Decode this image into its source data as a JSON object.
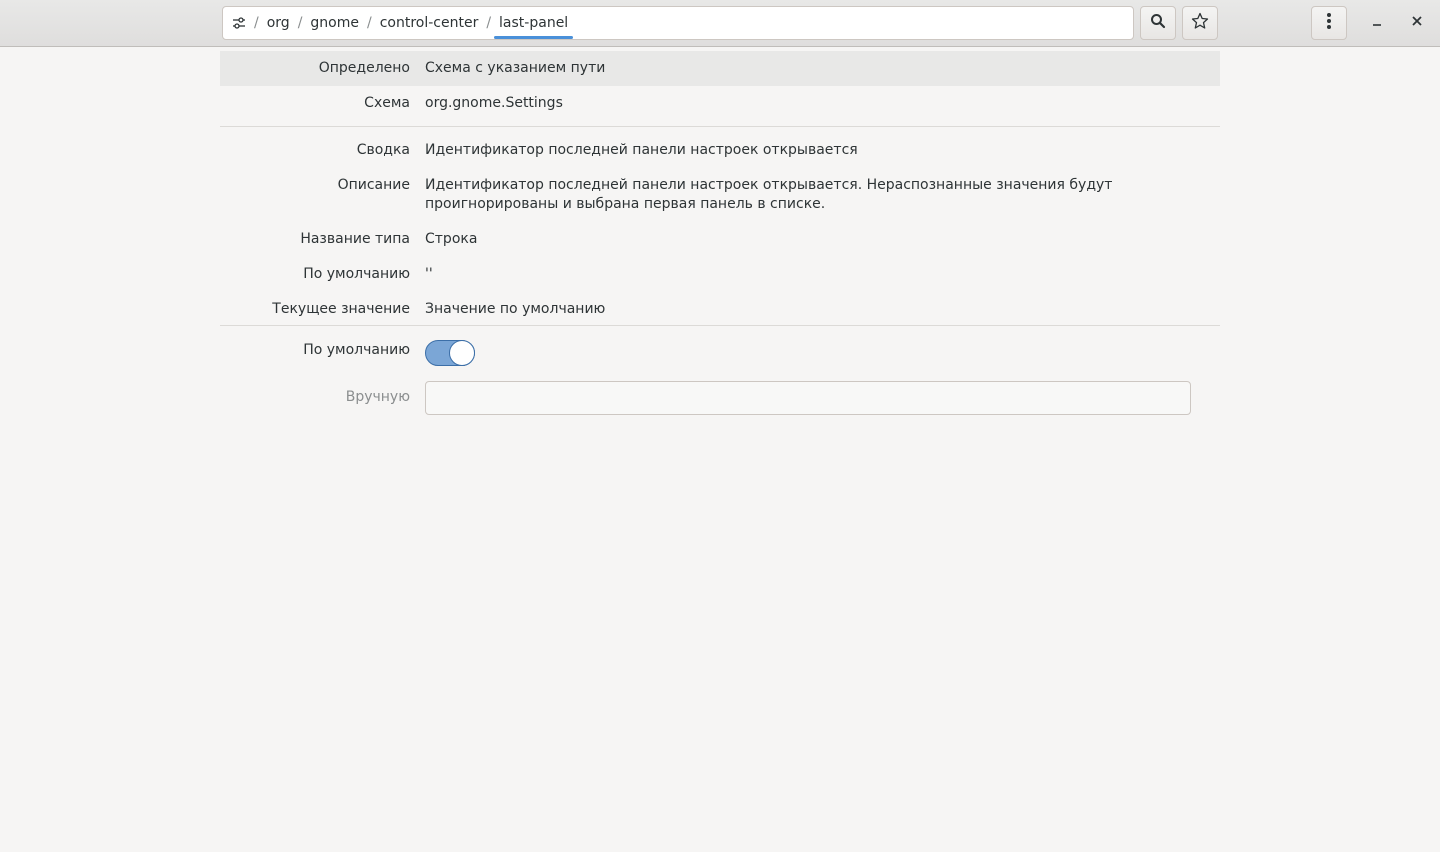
{
  "breadcrumb": {
    "items": [
      "org",
      "gnome",
      "control-center",
      "last-panel"
    ],
    "separator": "/",
    "active_index": 3
  },
  "icons": {
    "path": "settings-sliders-icon",
    "search": "search-icon",
    "bookmark": "star-icon",
    "menu": "vertical-dots-icon",
    "minimize": "minimize-icon",
    "close": "close-icon"
  },
  "info": {
    "defined_label": "Определено",
    "defined_value": "Схема с указанием пути",
    "schema_label": "Схема",
    "schema_value": "org.gnome.Settings",
    "summary_label": "Сводка",
    "summary_value": "Идентификатор последней панели настроек открывается",
    "description_label": "Описание",
    "description_value": "Идентификатор последней панели настроек открывается. Нераспознанные значения будут проигнорированы и выбрана первая панель в списке.",
    "type_label": "Название типа",
    "type_value": "Строка",
    "default_label": "По умолчанию",
    "default_value": "''",
    "current_label": "Текущее значение",
    "current_value": "Значение по умолчанию"
  },
  "edit": {
    "use_default_label": "По умолчанию",
    "use_default_on": true,
    "custom_label": "Вручную",
    "custom_value": ""
  },
  "colors": {
    "accent": "#4a90d9",
    "switch_on": "#7ba6d6"
  }
}
